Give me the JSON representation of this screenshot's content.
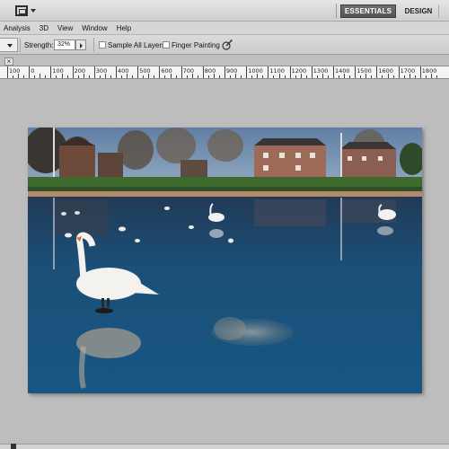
{
  "workspaces": {
    "active": "ESSENTIALS",
    "other": "DESIGN"
  },
  "menu": [
    "Analysis",
    "3D",
    "View",
    "Window",
    "Help"
  ],
  "options": {
    "strength_label": "Strength:",
    "strength_value": "32%",
    "sample_all_layers_label": "Sample All Layers",
    "sample_all_layers_checked": false,
    "finger_painting_label": "Finger Painting",
    "finger_painting_checked": false
  },
  "tab": {
    "close_symbol": "×"
  },
  "ruler": {
    "labels": [
      "100",
      "0",
      "100",
      "200",
      "300",
      "400",
      "500",
      "600",
      "700",
      "800",
      "900",
      "1000",
      "1100",
      "1200",
      "1300",
      "1400",
      "1500",
      "1600",
      "1700",
      "1800"
    ]
  },
  "icons": {
    "tool_preset": "crop-frame-icon",
    "pressure": "brush-pressure-icon"
  },
  "colors": {
    "active_workspace": "#5c5c5c",
    "canvas_bg": "#bdbdbd"
  }
}
